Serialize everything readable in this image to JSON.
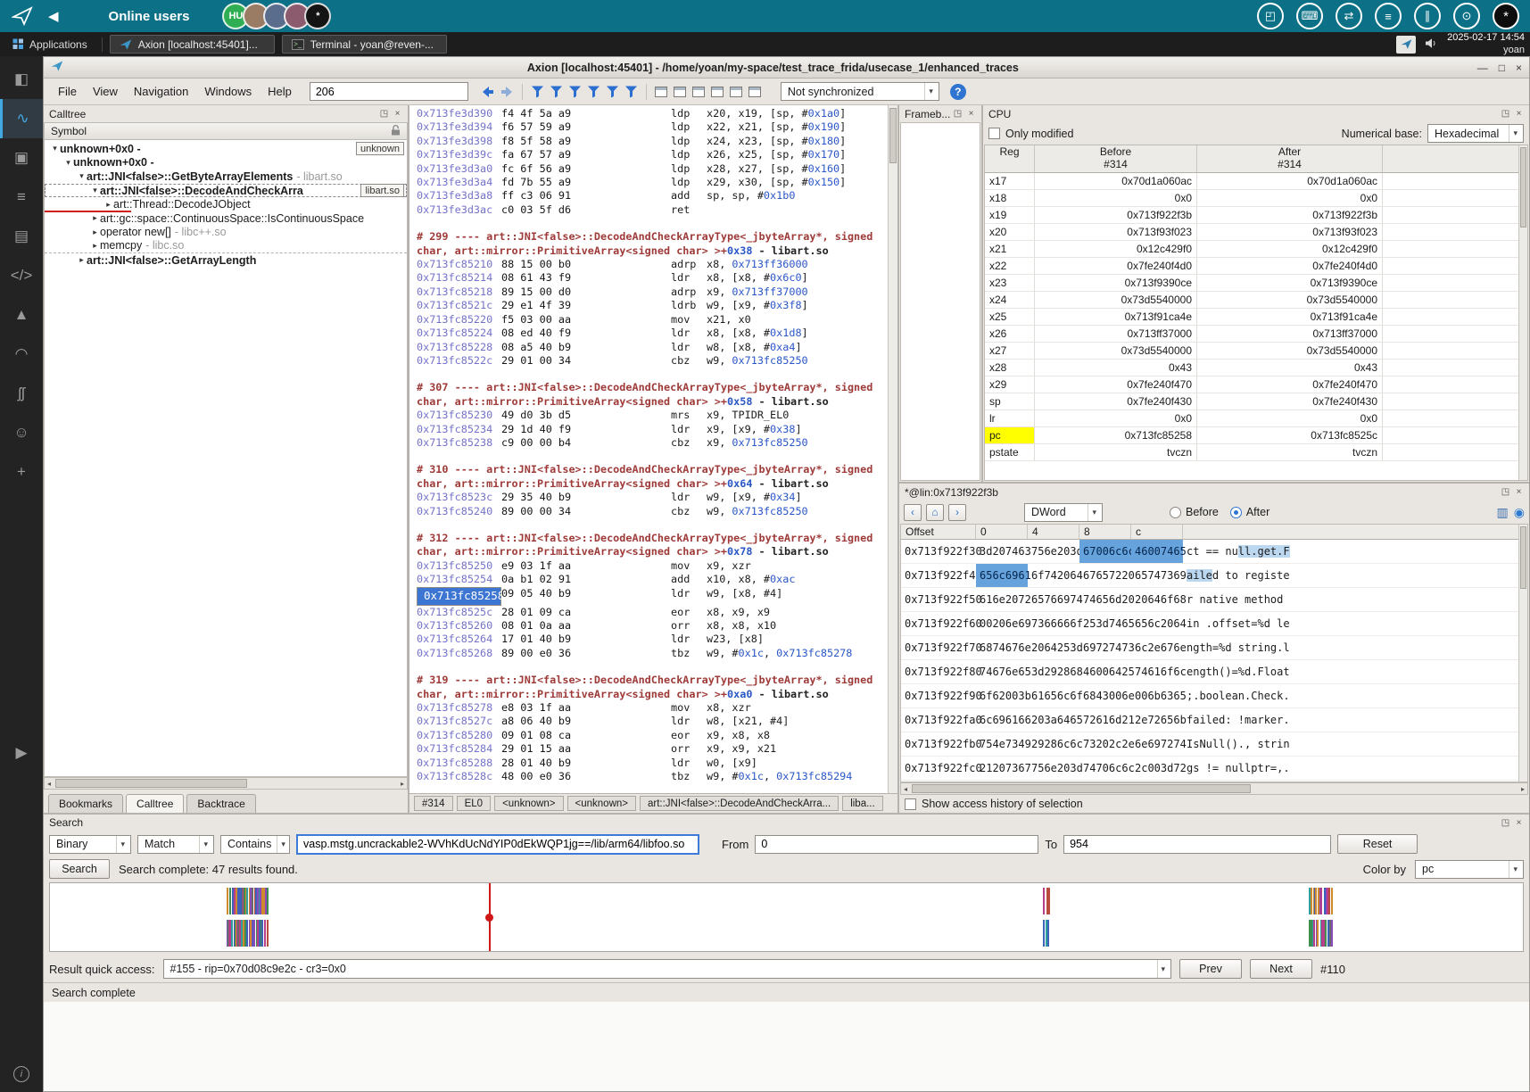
{
  "topbar": {
    "title": "Online users",
    "avatars": [
      {
        "label": "HU",
        "bg": "#2fae54"
      },
      {
        "label": "",
        "bg": "#9a7b64"
      },
      {
        "label": "",
        "bg": "#5b6d8c"
      },
      {
        "label": "",
        "bg": "#8c5b6d"
      },
      {
        "label": "*",
        "bg": "#141414"
      }
    ],
    "icons": [
      {
        "name": "screen-share-icon",
        "glyph": "◰"
      },
      {
        "name": "keyboard-icon",
        "glyph": "⌨"
      },
      {
        "name": "swap-icon",
        "glyph": "⇄"
      },
      {
        "name": "list-icon",
        "glyph": "≡"
      },
      {
        "name": "pause-icon",
        "glyph": "∥"
      },
      {
        "name": "power-icon",
        "glyph": "⊙"
      }
    ],
    "user_avatar": "*"
  },
  "taskbar": {
    "applications": "Applications",
    "windows": [
      "Axion [localhost:45401]...",
      "Terminal - yoan@reven-..."
    ],
    "clock": "2025-02-17 14:54",
    "user": "yoan"
  },
  "window": {
    "title": "Axion [localhost:45401] - /home/yoan/my-space/test_trace_frida/usecase_1/enhanced_traces",
    "controls": {
      "minimize": "—",
      "maximize": "□",
      "close": "×"
    }
  },
  "menubar": {
    "menus": [
      "File",
      "View",
      "Navigation",
      "Windows",
      "Help"
    ],
    "transition_value": "206",
    "sync_value": "Not synchronized",
    "help_label": "?",
    "toolbar_icons": [
      {
        "name": "goto-previous-icon",
        "kind": "back"
      },
      {
        "name": "goto-next-icon",
        "kind": "fwd"
      },
      {
        "name": "filter-calls-icon",
        "kind": "filter"
      },
      {
        "name": "filter-symbols-icon",
        "kind": "filter"
      },
      {
        "name": "filter-accesses-icon",
        "kind": "filter"
      },
      {
        "name": "filter-strings-icon",
        "kind": "filter"
      },
      {
        "name": "filter-memory-icon",
        "kind": "filter"
      },
      {
        "name": "filter-misc-icon",
        "kind": "filter"
      },
      {
        "name": "new-trace-view-icon",
        "kind": "panel"
      },
      {
        "name": "new-calltree-view-icon",
        "kind": "panel"
      },
      {
        "name": "new-cpu-view-icon",
        "kind": "panel"
      },
      {
        "name": "new-memory-view-icon",
        "kind": "panel"
      },
      {
        "name": "new-search-view-icon",
        "kind": "panel"
      },
      {
        "name": "new-framebuffer-view-icon",
        "kind": "panel"
      }
    ]
  },
  "dock": {
    "items": [
      {
        "name": "layout-panel-icon",
        "glyph": "◧",
        "active": false
      },
      {
        "name": "trace-activity-icon",
        "glyph": "∿",
        "active": true
      },
      {
        "name": "package-icon",
        "glyph": "▣",
        "active": false
      },
      {
        "name": "tasks-icon",
        "glyph": "≡",
        "active": false
      },
      {
        "name": "document-icon",
        "glyph": "▤",
        "active": false
      },
      {
        "name": "code-icon",
        "glyph": "</>",
        "active": false
      },
      {
        "name": "education-icon",
        "glyph": "▲",
        "active": false
      },
      {
        "name": "wifi-icon",
        "glyph": "◠",
        "active": false
      },
      {
        "name": "steam-icon",
        "glyph": "ʃʃ",
        "active": false
      },
      {
        "name": "smiley-icon",
        "glyph": "☺",
        "active": false
      },
      {
        "name": "add-icon",
        "glyph": "+",
        "active": false
      }
    ],
    "play_glyph": "▶",
    "info_glyph": "i"
  },
  "calltree": {
    "title": "Calltree",
    "column": "Symbol",
    "rows": [
      {
        "depth": 0,
        "arrow": "down",
        "label": "unknown+0x0 -",
        "bold": true,
        "badge": "unknown"
      },
      {
        "depth": 1,
        "arrow": "down",
        "label": "unknown+0x0 -",
        "bold": true
      },
      {
        "depth": 2,
        "arrow": "down",
        "label": "art::JNI<false>::GetByteArrayElements",
        "suffix": "- libart.so",
        "bold": true
      },
      {
        "depth": 3,
        "arrow": "down",
        "label": "art::JNI<false>::DecodeAndCheckArra",
        "bold": true,
        "badge": "libart.so",
        "selected": true
      },
      {
        "depth": 4,
        "arrow": "right",
        "label": "art::Thread::DecodeJObject",
        "marker": true
      },
      {
        "depth": 3,
        "arrow": "right",
        "label": "art::gc::space::ContinuousSpace::IsContinuousSpace"
      },
      {
        "depth": 3,
        "arrow": "right",
        "label": "operator new[]",
        "suffix": "- libc++.so"
      },
      {
        "depth": 3,
        "arrow": "right",
        "label": "memcpy",
        "suffix": "- libc.so",
        "dashed": true
      },
      {
        "depth": 2,
        "arrow": "right",
        "label": "art::JNI<false>::GetArrayLength",
        "bold": true
      }
    ],
    "tabs": [
      "Bookm​arks",
      "Calltree",
      "Backtrace"
    ],
    "active_tab": "Calltree"
  },
  "asm": {
    "blocks": [
      {
        "lines": [
          [
            "0x713fe3d390",
            "f4 4f 5a a9",
            "ldp",
            "x20, x19, [sp, #0x1a0]"
          ],
          [
            "0x713fe3d394",
            "f6 57 59 a9",
            "ldp",
            "x22, x21, [sp, #0x190]"
          ],
          [
            "0x713fe3d398",
            "f8 5f 58 a9",
            "ldp",
            "x24, x23, [sp, #0x180]"
          ],
          [
            "0x713fe3d39c",
            "fa 67 57 a9",
            "ldp",
            "x26, x25, [sp, #0x170]"
          ],
          [
            "0x713fe3d3a0",
            "fc 6f 56 a9",
            "ldp",
            "x28, x27, [sp, #0x160]"
          ],
          [
            "0x713fe3d3a4",
            "fd 7b 55 a9",
            "ldp",
            "x29, x30, [sp, #0x150]"
          ],
          [
            "0x713fe3d3a8",
            "ff c3 06 91",
            "add",
            "sp, sp, #0x1b0"
          ],
          [
            "0x713fe3d3ac",
            "c0 03 5f d6",
            "ret",
            ""
          ]
        ]
      },
      {
        "num": "# 299",
        "name": "art::JNI<false>::DecodeAndCheckArrayType<_jbyteArray*, signed char, art::mirror::PrimitiveArray<signed char> >+",
        "offset": "0x38",
        "lib": " - libart.so",
        "lines": [
          [
            "0x713fc85210",
            "88 15 00 b0",
            "adrp",
            "x8, 0x713ff36000"
          ],
          [
            "0x713fc85214",
            "08 61 43 f9",
            "ldr",
            "x8, [x8, #0x6c0]"
          ],
          [
            "0x713fc85218",
            "89 15 00 d0",
            "adrp",
            "x9, 0x713ff37000"
          ],
          [
            "0x713fc8521c",
            "29 e1 4f 39",
            "ldrb",
            "w9, [x9, #0x3f8]"
          ],
          [
            "0x713fc85220",
            "f5 03 00 aa",
            "mov",
            "x21, x0"
          ],
          [
            "0x713fc85224",
            "08 ed 40 f9",
            "ldr",
            "x8, [x8, #0x1d8]"
          ],
          [
            "0x713fc85228",
            "08 a5 40 b9",
            "ldr",
            "w8, [x8, #0xa4]"
          ],
          [
            "0x713fc8522c",
            "29 01 00 34",
            "cbz",
            "w9, 0x713fc85250"
          ]
        ]
      },
      {
        "num": "# 307",
        "name": "art::JNI<false>::DecodeAndCheckArrayType<_jbyteArray*, signed char, art::mirror::PrimitiveArray<signed char> >+",
        "offset": "0x58",
        "lib": " - libart.so",
        "lines": [
          [
            "0x713fc85230",
            "49 d0 3b d5",
            "mrs",
            "x9, TPIDR_EL0"
          ],
          [
            "0x713fc85234",
            "29 1d 40 f9",
            "ldr",
            "x9, [x9, #0x38]"
          ],
          [
            "0x713fc85238",
            "c9 00 00 b4",
            "cbz",
            "x9, 0x713fc85250"
          ]
        ]
      },
      {
        "num": "# 310",
        "name": "art::JNI<false>::DecodeAndCheckArrayType<_jbyteArray*, signed char, art::mirror::PrimitiveArray<signed char> >+",
        "offset": "0x64",
        "lib": " - libart.so",
        "lines": [
          [
            "0x713fc8523c",
            "29 35 40 b9",
            "ldr",
            "w9, [x9, #0x34]"
          ],
          [
            "0x713fc85240",
            "89 00 00 34",
            "cbz",
            "w9, 0x713fc85250"
          ]
        ]
      },
      {
        "num": "# 312",
        "name": "art::JNI<false>::DecodeAndCheckArrayType<_jbyteArray*, signed char, art::mirror::PrimitiveArray<signed char> >+",
        "offset": "0x78",
        "lib": " - libart.so",
        "lines": [
          [
            "0x713fc85250",
            "e9 03 1f aa",
            "mov",
            "x9, xzr"
          ],
          [
            "0x713fc85254",
            "0a b1 02 91",
            "add",
            "x10, x8, #0xac"
          ],
          [
            "0x713fc85258",
            "09 05 40 b9",
            "ldr",
            "w9, [x8, #4]",
            "sel"
          ],
          [
            "0x713fc8525c",
            "28 01 09 ca",
            "eor",
            "x8, x9, x9"
          ],
          [
            "0x713fc85260",
            "08 01 0a aa",
            "orr",
            "x8, x8, x10"
          ],
          [
            "0x713fc85264",
            "17 01 40 b9",
            "ldr",
            "w23, [x8]"
          ],
          [
            "0x713fc85268",
            "89 00 e0 36",
            "tbz",
            "w9, #0x1c, 0x713fc85278"
          ]
        ]
      },
      {
        "num": "# 319",
        "name": "art::JNI<false>::DecodeAndCheckArrayType<_jbyteArray*, signed char, art::mirror::PrimitiveArray<signed char> >+",
        "offset": "0xa0",
        "lib": " - libart.so",
        "lines": [
          [
            "0x713fc85278",
            "e8 03 1f aa",
            "mov",
            "x8, xzr"
          ],
          [
            "0x713fc8527c",
            "a8 06 40 b9",
            "ldr",
            "w8, [x21, #4]"
          ],
          [
            "0x713fc85280",
            "09 01 08 ca",
            "eor",
            "x9, x8, x8"
          ],
          [
            "0x713fc85284",
            "29 01 15 aa",
            "orr",
            "x9, x9, x21"
          ],
          [
            "0x713fc85288",
            "28 01 40 b9",
            "ldr",
            "w0, [x9]"
          ],
          [
            "0x713fc8528c",
            "48 00 e0 36",
            "tbz",
            "w9, #0x1c, 0x713fc85294"
          ]
        ]
      }
    ]
  },
  "crumbs": [
    "#314",
    "EL0",
    "<unknown>",
    "<unknown>",
    "art::JNI<false>::DecodeAndCheckArra...",
    "liba..."
  ],
  "framebuffer": {
    "title": "Frameb..."
  },
  "cpu": {
    "title": "CPU",
    "only_modified_label": "Only modified",
    "numerical_base_label": "Numerical base:",
    "numerical_base_value": "Hexadecimal",
    "col_reg": "Reg",
    "col_before": "Before",
    "col_after": "After",
    "tick": "#314",
    "registers": [
      {
        "name": "x17",
        "before": "0x70d1a060ac",
        "after": "0x70d1a060ac"
      },
      {
        "name": "x18",
        "before": "0x0",
        "after": "0x0"
      },
      {
        "name": "x19",
        "before": "0x713f922f3b",
        "after": "0x713f922f3b"
      },
      {
        "name": "x20",
        "before": "0x713f93f023",
        "after": "0x713f93f023"
      },
      {
        "name": "x21",
        "before": "0x12c429f0",
        "after": "0x12c429f0"
      },
      {
        "name": "x22",
        "before": "0x7fe240f4d0",
        "after": "0x7fe240f4d0"
      },
      {
        "name": "x23",
        "before": "0x713f9390ce",
        "after": "0x713f9390ce"
      },
      {
        "name": "x24",
        "before": "0x73d5540000",
        "after": "0x73d5540000"
      },
      {
        "name": "x25",
        "before": "0x713f91ca4e",
        "after": "0x713f91ca4e"
      },
      {
        "name": "x26",
        "before": "0x713ff37000",
        "after": "0x713ff37000"
      },
      {
        "name": "x27",
        "before": "0x73d5540000",
        "after": "0x73d5540000"
      },
      {
        "name": "x28",
        "before": "0x43",
        "after": "0x43"
      },
      {
        "name": "x29",
        "before": "0x7fe240f470",
        "after": "0x7fe240f470"
      },
      {
        "name": "sp",
        "before": "0x7fe240f430",
        "after": "0x7fe240f430"
      },
      {
        "name": "lr",
        "before": "0x0",
        "after": "0x0"
      },
      {
        "name": "pc",
        "before": "0x713fc85258",
        "after": "0x713fc8525c",
        "highlight": true
      },
      {
        "name": "pstate",
        "before": "tvczn",
        "after": "tvczn"
      }
    ]
  },
  "memory": {
    "title": "*@lin:0x713f922f3b",
    "unit_value": "DWord",
    "before_label": "Before",
    "after_label": "After",
    "selected_radio": "After",
    "headers": [
      "Offset",
      "0",
      "4",
      "8",
      "c"
    ],
    "rows": [
      {
        "offset": "0x713f922f30",
        "cells": [
          [
            "3d207463",
            0
          ],
          [
            "756e203d",
            0
          ],
          [
            "67006c6c",
            1
          ],
          [
            "46007465",
            1
          ]
        ],
        "ascii": [
          [
            "ct == nu",
            0
          ],
          [
            "ll.get.F",
            1
          ]
        ]
      },
      {
        "offset": "0x713f922f40",
        "cells": [
          [
            "656c6961",
            1
          ],
          [
            "6f742064",
            0
          ],
          [
            "67657220",
            0
          ],
          [
            "65747369",
            0
          ]
        ],
        "ascii": [
          [
            "aile",
            1
          ],
          [
            "d to registe",
            0
          ]
        ]
      },
      {
        "offset": "0x713f922f50",
        "cells": [
          [
            "616e2072",
            0
          ],
          [
            "65766974",
            0
          ],
          [
            "74656d20",
            0
          ],
          [
            "20646f68",
            0
          ]
        ],
        "ascii": [
          [
            "r native method ",
            0
          ]
        ]
      },
      {
        "offset": "0x713f922f60",
        "cells": [
          [
            "00206e69",
            0
          ],
          [
            "7366666f",
            0
          ],
          [
            "253d7465",
            0
          ],
          [
            "656c2064",
            0
          ]
        ],
        "ascii": [
          [
            "in .offset=%d le",
            0
          ]
        ]
      },
      {
        "offset": "0x713f922f70",
        "cells": [
          [
            "6874676e",
            0
          ],
          [
            "2064253d",
            0
          ],
          [
            "69727473",
            0
          ],
          [
            "6c2e676e",
            0
          ]
        ],
        "ascii": [
          [
            "ngth=%d string.l",
            0
          ]
        ]
      },
      {
        "offset": "0x713f922f80",
        "cells": [
          [
            "74676e65",
            0
          ],
          [
            "3d292868",
            0
          ],
          [
            "46006425",
            0
          ],
          [
            "74616f6c",
            0
          ]
        ],
        "ascii": [
          [
            "ength()=%d.Float",
            0
          ]
        ]
      },
      {
        "offset": "0x713f922f90",
        "cells": [
          [
            "6f62003b",
            0
          ],
          [
            "61656c6f",
            0
          ],
          [
            "6843006e",
            0
          ],
          [
            "006b6365",
            0
          ]
        ],
        "ascii": [
          [
            ";.boolean.Check.",
            0
          ]
        ]
      },
      {
        "offset": "0x713f922fa0",
        "cells": [
          [
            "6c696166",
            0
          ],
          [
            "203a6465",
            0
          ],
          [
            "72616d21",
            0
          ],
          [
            "2e72656b",
            0
          ]
        ],
        "ascii": [
          [
            "failed: !marker.",
            0
          ]
        ]
      },
      {
        "offset": "0x713f922fb0",
        "cells": [
          [
            "754e7349",
            0
          ],
          [
            "29286c6c",
            0
          ],
          [
            "73202c2e",
            0
          ],
          [
            "6e697274",
            0
          ]
        ],
        "ascii": [
          [
            "IsNull()., strin",
            0
          ]
        ]
      },
      {
        "offset": "0x713f922fc0",
        "cells": [
          [
            "21207367",
            0
          ],
          [
            "756e203d",
            0
          ],
          [
            "74706c6c",
            0
          ],
          [
            "2c003d72",
            0
          ]
        ],
        "ascii": [
          [
            "gs != nullptr=,.",
            0
          ]
        ]
      }
    ],
    "show_access_label": "Show access history of selection"
  },
  "search": {
    "title": "Search",
    "type_value": "Binary",
    "match_value": "Match",
    "mode_value": "Contains",
    "query": "vasp.mstg.uncrackable2-WVhKdUcNdYIP0dEkWQP1jg==/lib/arm64/libfoo.so",
    "from_label": "From",
    "from_value": "0",
    "to_label": "To",
    "to_value": "954",
    "reset_label": "Reset",
    "search_label": "Search",
    "status": "Search complete:  47 results found.",
    "color_by_label": "Color by",
    "color_by_value": "pc"
  },
  "timeline": {
    "cursor_pct": 29.8,
    "clusters": [
      {
        "pos": 11.9,
        "count": 30,
        "spread": 2.8
      },
      {
        "pos": 67.4,
        "count": 3,
        "spread": 0.5
      },
      {
        "pos": 85.4,
        "count": 13,
        "spread": 1.6
      }
    ],
    "palette": [
      "#b94a3e",
      "#3e8e4f",
      "#3e62b9",
      "#8a4ab9",
      "#cf8a2e",
      "#2e9e9e",
      "#b93e8a",
      "#6a6a6a"
    ]
  },
  "quick_access": {
    "label": "Result quick access:",
    "value": "#155 - rip=0x70d08c9e2c - cr3=0x0",
    "prev": "Prev",
    "next": "Next",
    "count": "#110"
  },
  "statusbar": "Search complete"
}
